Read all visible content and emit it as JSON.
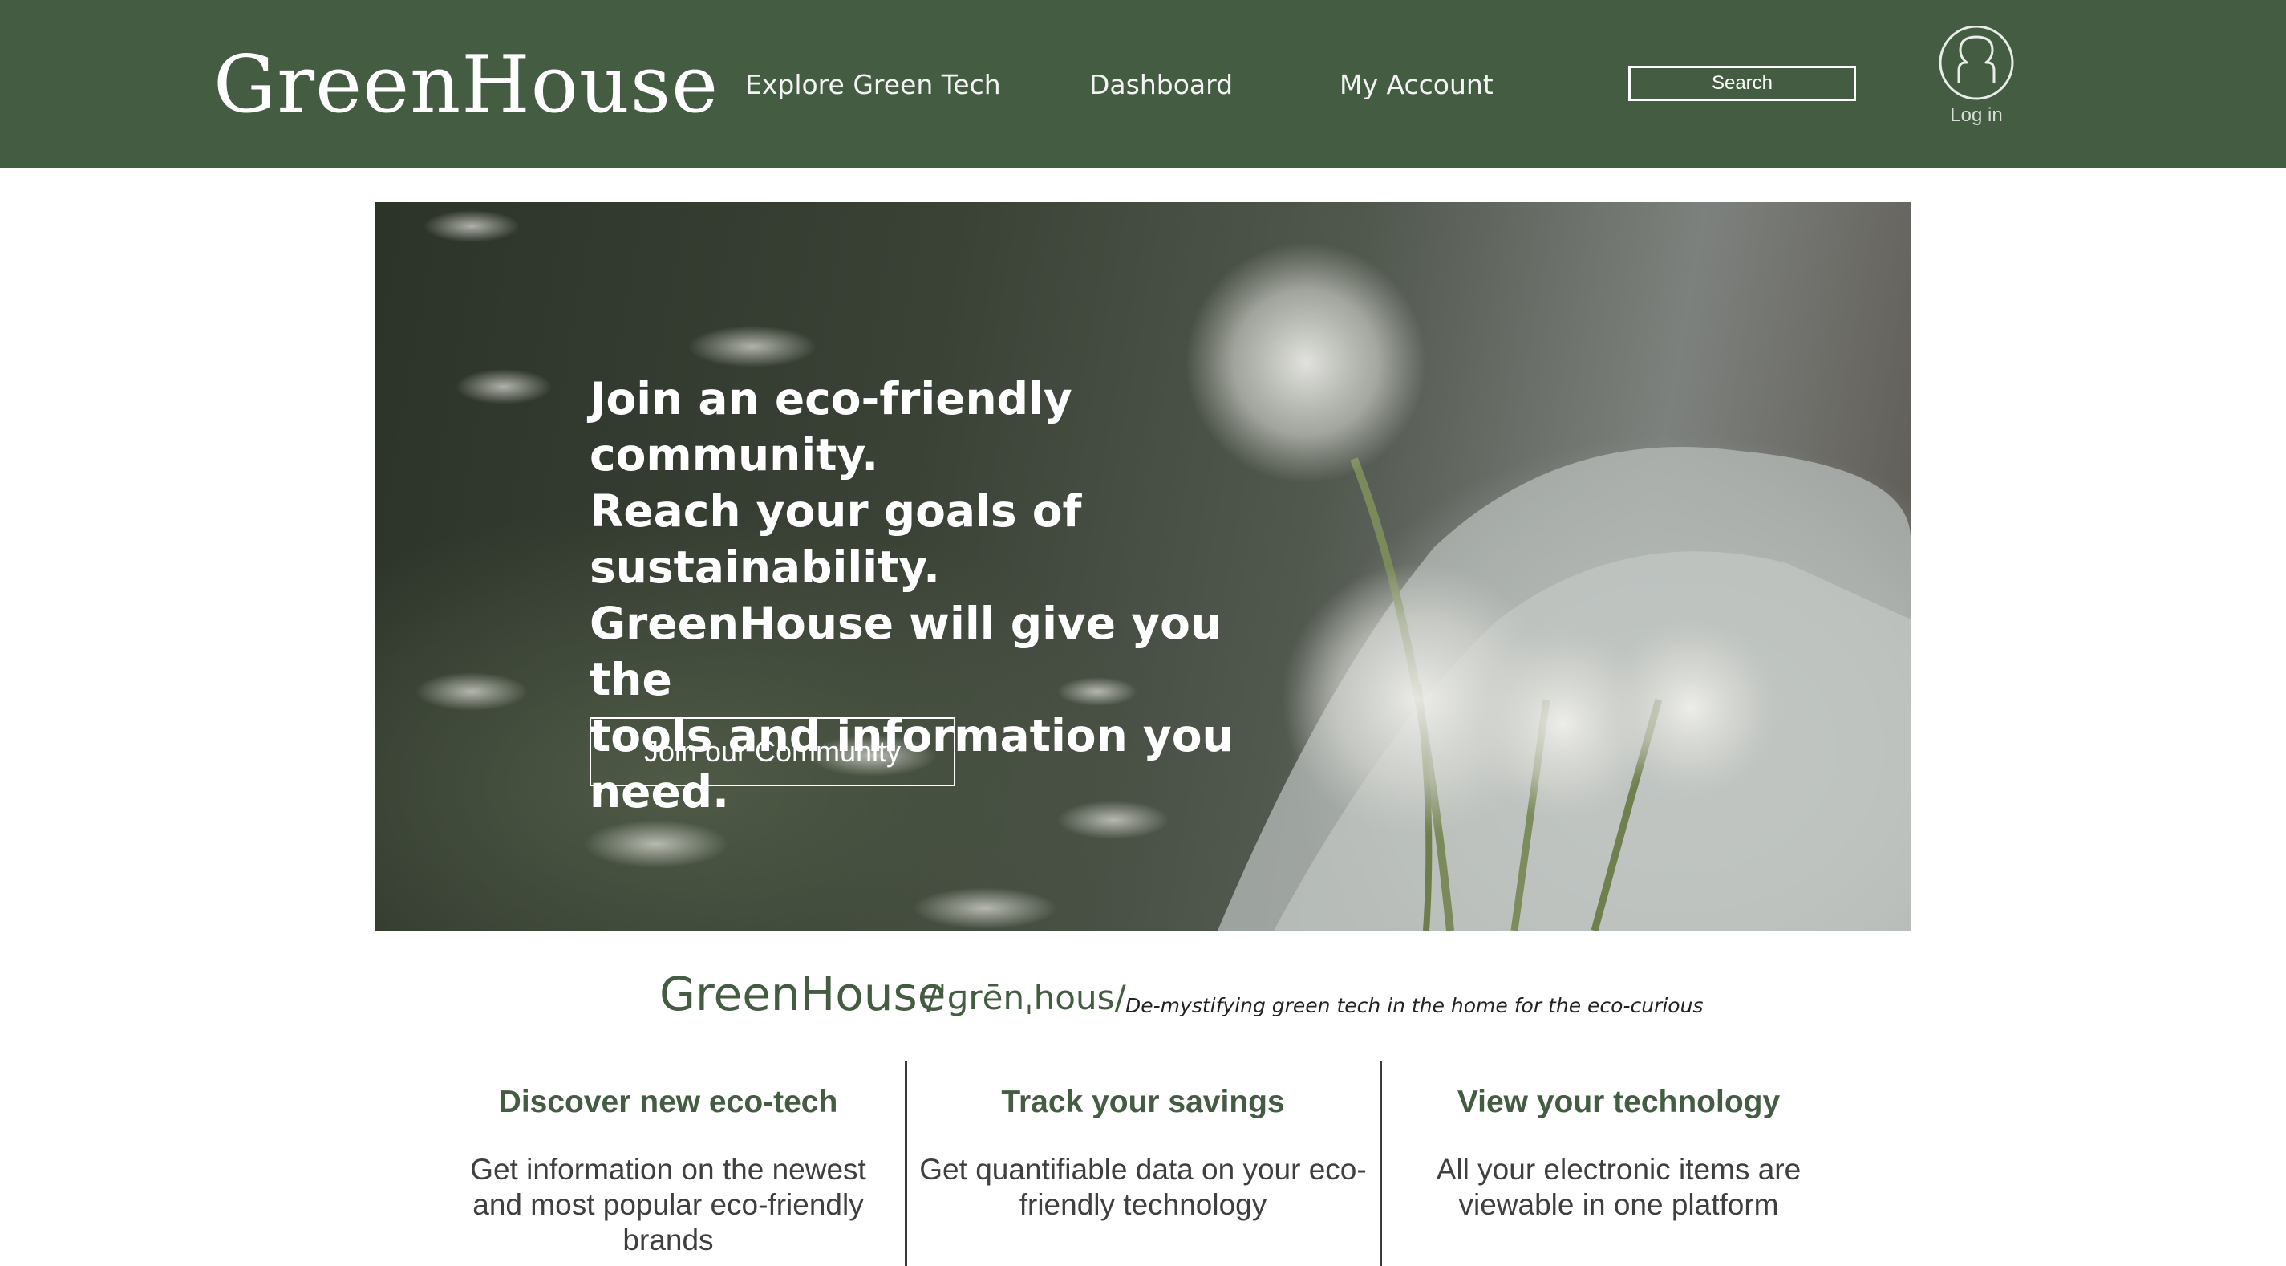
{
  "header": {
    "logo": "GreenHouse",
    "nav": {
      "explore": "Explore Green Tech",
      "dashboard": "Dashboard",
      "account": "My Account"
    },
    "search_label": "Search",
    "login_label": "Log in",
    "background_color": "#445c42"
  },
  "hero": {
    "lines": [
      "Join an eco-friendly",
      "community.",
      "Reach your goals of",
      "sustainability.",
      "GreenHouse will give you the",
      "tools and information you need."
    ],
    "cta_label": "Join our Community"
  },
  "definition": {
    "word": "GreenHouse",
    "phonetic": "/ˈɡrēnˌhous/",
    "tagline": "De-mystifying green tech in the home for the eco-curious"
  },
  "features": [
    {
      "title": "Discover new eco-tech",
      "text": "Get information on the newest and most popular eco-friendly brands"
    },
    {
      "title": "Track your savings",
      "text": "Get quantifiable data on your eco-friendly technology"
    },
    {
      "title": "View your technology",
      "text": "All your electronic items are viewable in one platform"
    }
  ],
  "icons": {
    "login": "user-icon"
  }
}
